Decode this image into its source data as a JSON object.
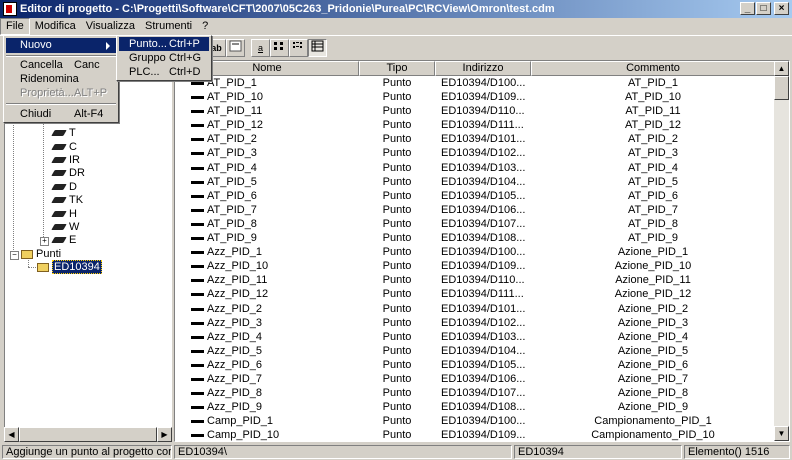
{
  "window": {
    "title": "Editor di progetto - C:\\Progetti\\Software\\CFT\\2007\\05C263_Pridonie\\Purea\\PC\\RCView\\Omron\\test.cdm",
    "min": "_",
    "max": "□",
    "close": "×"
  },
  "menubar": [
    {
      "label": "File"
    },
    {
      "label": "Modifica"
    },
    {
      "label": "Visualizza"
    },
    {
      "label": "Strumenti"
    },
    {
      "label": "?"
    }
  ],
  "file_menu": {
    "items": [
      {
        "label": "Nuovo",
        "shortcut": "",
        "state": "highlighted"
      },
      {
        "label": "Cancella",
        "shortcut": "Canc",
        "state": "normal"
      },
      {
        "label": "Ridenomina",
        "shortcut": "",
        "state": "normal"
      },
      {
        "label": "Proprietà...",
        "shortcut": "ALT+P",
        "state": "disabled"
      },
      {
        "label": "Chiudi",
        "shortcut": "Alt-F4",
        "state": "normal"
      }
    ]
  },
  "nuovo_submenu": {
    "items": [
      {
        "label": "Punto...",
        "shortcut": "Ctrl+P",
        "state": "highlighted"
      },
      {
        "label": "Gruppo",
        "shortcut": "Ctrl+G",
        "state": "normal"
      },
      {
        "label": "PLC...",
        "shortcut": "Ctrl+D",
        "state": "normal"
      }
    ]
  },
  "toolbar": {
    "buttons": [
      {
        "name": "details-view",
        "glyph": "ab"
      },
      {
        "name": "properties",
        "glyph": ""
      },
      {
        "name": "large-icons",
        "glyph": "a"
      },
      {
        "name": "small-icons",
        "glyph": ""
      },
      {
        "name": "list-view",
        "glyph": ""
      },
      {
        "name": "details-list",
        "glyph": ""
      }
    ]
  },
  "tree": {
    "items": [
      {
        "label": "T"
      },
      {
        "label": "C"
      },
      {
        "label": "IR"
      },
      {
        "label": "DR"
      },
      {
        "label": "D"
      },
      {
        "label": "TK"
      },
      {
        "label": "H"
      },
      {
        "label": "W"
      },
      {
        "label": "E"
      }
    ],
    "punti_label": "Punti",
    "selected_label": "ED10394"
  },
  "list": {
    "columns": [
      "Nome",
      "Tipo",
      "Indirizzo",
      "Commento"
    ],
    "rows": [
      {
        "name": "AT_PID_1",
        "type": "Punto",
        "address": "ED10394/D100...",
        "comment": "AT_PID_1"
      },
      {
        "name": "AT_PID_10",
        "type": "Punto",
        "address": "ED10394/D109...",
        "comment": "AT_PID_10"
      },
      {
        "name": "AT_PID_11",
        "type": "Punto",
        "address": "ED10394/D110...",
        "comment": "AT_PID_11"
      },
      {
        "name": "AT_PID_12",
        "type": "Punto",
        "address": "ED10394/D111...",
        "comment": "AT_PID_12"
      },
      {
        "name": "AT_PID_2",
        "type": "Punto",
        "address": "ED10394/D101...",
        "comment": "AT_PID_2"
      },
      {
        "name": "AT_PID_3",
        "type": "Punto",
        "address": "ED10394/D102...",
        "comment": "AT_PID_3"
      },
      {
        "name": "AT_PID_4",
        "type": "Punto",
        "address": "ED10394/D103...",
        "comment": "AT_PID_4"
      },
      {
        "name": "AT_PID_5",
        "type": "Punto",
        "address": "ED10394/D104...",
        "comment": "AT_PID_5"
      },
      {
        "name": "AT_PID_6",
        "type": "Punto",
        "address": "ED10394/D105...",
        "comment": "AT_PID_6"
      },
      {
        "name": "AT_PID_7",
        "type": "Punto",
        "address": "ED10394/D106...",
        "comment": "AT_PID_7"
      },
      {
        "name": "AT_PID_8",
        "type": "Punto",
        "address": "ED10394/D107...",
        "comment": "AT_PID_8"
      },
      {
        "name": "AT_PID_9",
        "type": "Punto",
        "address": "ED10394/D108...",
        "comment": "AT_PID_9"
      },
      {
        "name": "Azz_PID_1",
        "type": "Punto",
        "address": "ED10394/D100...",
        "comment": "Azione_PID_1"
      },
      {
        "name": "Azz_PID_10",
        "type": "Punto",
        "address": "ED10394/D109...",
        "comment": "Azione_PID_10"
      },
      {
        "name": "Azz_PID_11",
        "type": "Punto",
        "address": "ED10394/D110...",
        "comment": "Azione_PID_11"
      },
      {
        "name": "Azz_PID_12",
        "type": "Punto",
        "address": "ED10394/D111...",
        "comment": "Azione_PID_12"
      },
      {
        "name": "Azz_PID_2",
        "type": "Punto",
        "address": "ED10394/D101...",
        "comment": "Azione_PID_2"
      },
      {
        "name": "Azz_PID_3",
        "type": "Punto",
        "address": "ED10394/D102...",
        "comment": "Azione_PID_3"
      },
      {
        "name": "Azz_PID_4",
        "type": "Punto",
        "address": "ED10394/D103...",
        "comment": "Azione_PID_4"
      },
      {
        "name": "Azz_PID_5",
        "type": "Punto",
        "address": "ED10394/D104...",
        "comment": "Azione_PID_5"
      },
      {
        "name": "Azz_PID_6",
        "type": "Punto",
        "address": "ED10394/D105...",
        "comment": "Azione_PID_6"
      },
      {
        "name": "Azz_PID_7",
        "type": "Punto",
        "address": "ED10394/D106...",
        "comment": "Azione_PID_7"
      },
      {
        "name": "Azz_PID_8",
        "type": "Punto",
        "address": "ED10394/D107...",
        "comment": "Azione_PID_8"
      },
      {
        "name": "Azz_PID_9",
        "type": "Punto",
        "address": "ED10394/D108...",
        "comment": "Azione_PID_9"
      },
      {
        "name": "Camp_PID_1",
        "type": "Punto",
        "address": "ED10394/D100...",
        "comment": "Campionamento_PID_1"
      },
      {
        "name": "Camp_PID_10",
        "type": "Punto",
        "address": "ED10394/D109...",
        "comment": "Campionamento_PID_10"
      }
    ]
  },
  "statusbar": {
    "hint": "Aggiunge un punto al progetto corrente.",
    "path": "ED10394\\",
    "plc": "ED10394",
    "count": "Elemento() 1516"
  }
}
